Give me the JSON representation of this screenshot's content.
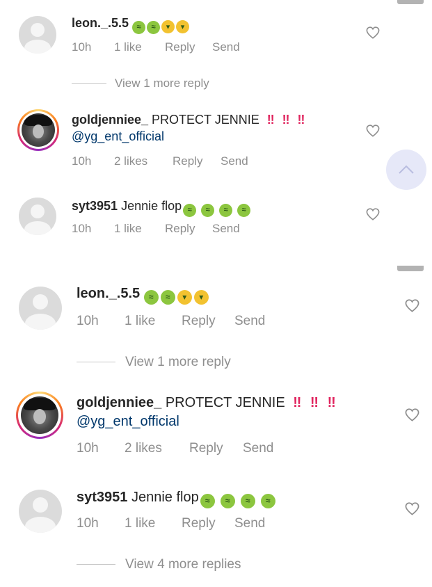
{
  "colors": {
    "meta": "#8e8e8e",
    "mention": "#00376b",
    "exclaim": "#e0245e",
    "scroll_button": "#e6e8f8"
  },
  "panels": [
    {
      "comments": [
        {
          "username": "leon._.5.5",
          "text": "",
          "emojis": [
            "nauseated-face",
            "nauseated-face",
            "vomiting-face",
            "vomiting-face"
          ],
          "time": "10h",
          "likes": "1 like",
          "reply": "Reply",
          "send": "Send",
          "view_more": "View 1 more reply"
        },
        {
          "username": "goldjenniee_",
          "text": "PROTECT JENNIE",
          "exclaims": [
            "‼",
            "‼",
            "‼"
          ],
          "mention": "@yg_ent_official",
          "time": "10h",
          "likes": "2 likes",
          "reply": "Reply",
          "send": "Send"
        },
        {
          "username": "syt3951",
          "text": "Jennie flop",
          "emojis": [
            "nauseated-face",
            "nauseated-face",
            "nauseated-face",
            "nauseated-face"
          ],
          "time": "10h",
          "likes": "1 like",
          "reply": "Reply",
          "send": "Send"
        }
      ]
    },
    {
      "comments": [
        {
          "username": "leon._.5.5",
          "text": "",
          "emojis": [
            "nauseated-face",
            "nauseated-face",
            "vomiting-face",
            "vomiting-face"
          ],
          "time": "10h",
          "likes": "1 like",
          "reply": "Reply",
          "send": "Send",
          "view_more": "View 1 more reply"
        },
        {
          "username": "goldjenniee_",
          "text": "PROTECT JENNIE",
          "exclaims": [
            "‼",
            "‼",
            "‼"
          ],
          "mention": "@yg_ent_official",
          "time": "10h",
          "likes": "2 likes",
          "reply": "Reply",
          "send": "Send"
        },
        {
          "username": "syt3951",
          "text": "Jennie flop",
          "emojis": [
            "nauseated-face",
            "nauseated-face",
            "nauseated-face",
            "nauseated-face"
          ],
          "time": "10h",
          "likes": "1 like",
          "reply": "Reply",
          "send": "Send",
          "view_more": "View 4 more replies"
        }
      ]
    }
  ],
  "icons": {
    "like": "heart-outline-icon",
    "scroll_top": "chevron-up-icon",
    "avatar": "default-avatar-icon"
  }
}
